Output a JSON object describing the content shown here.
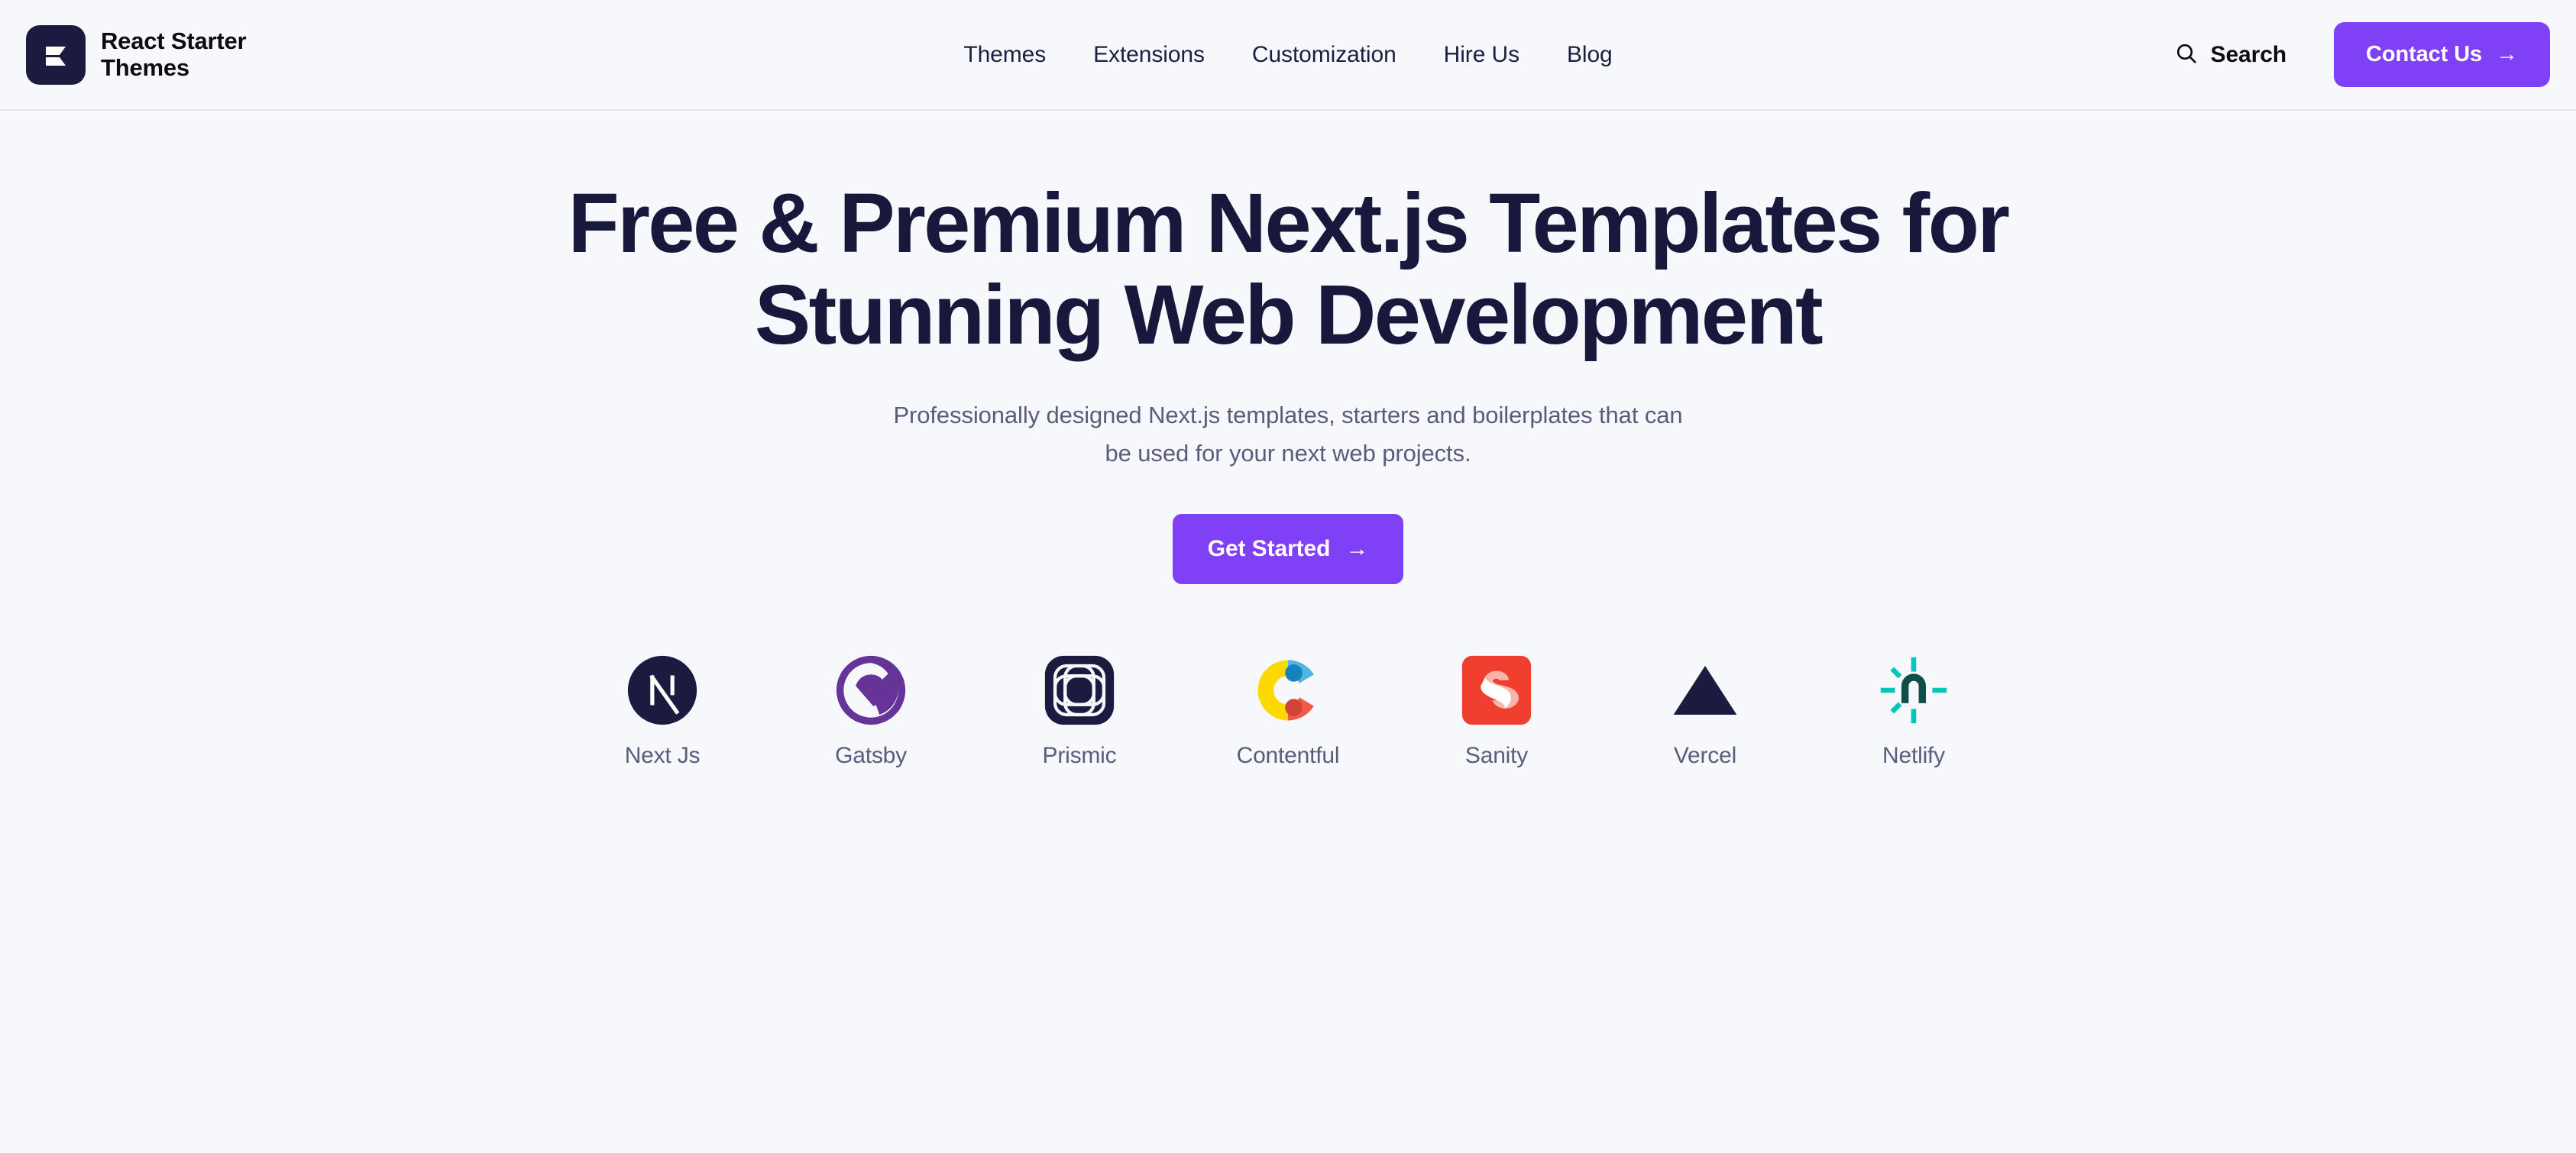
{
  "header": {
    "brand": {
      "name": "React Starter\nThemes",
      "logo_icon": "react-starter-themes-logo",
      "logo_bg": "#1b1b3f"
    },
    "nav": [
      {
        "label": "Themes"
      },
      {
        "label": "Extensions"
      },
      {
        "label": "Customization"
      },
      {
        "label": "Hire Us"
      },
      {
        "label": "Blog"
      }
    ],
    "search": {
      "label": "Search",
      "icon": "search-icon"
    },
    "contact": {
      "label": "Contact Us",
      "arrow": "→",
      "bg": "#8040f5",
      "color": "#ffffff"
    }
  },
  "hero": {
    "headline": "Free & Premium Next.js Templates for Stunning Web Development",
    "subtitle": "Professionally designed Next.js templates, starters and boilerplates that can be used for your next web projects.",
    "cta": {
      "label": "Get Started",
      "arrow": "→",
      "bg": "#8040f5",
      "color": "#ffffff"
    }
  },
  "tech_stack": [
    {
      "label": "Next Js",
      "icon": "nextjs-icon",
      "color": "#1b1b3f"
    },
    {
      "label": "Gatsby",
      "icon": "gatsby-icon",
      "color": "#663399"
    },
    {
      "label": "Prismic",
      "icon": "prismic-icon",
      "color": "#1b1b3f"
    },
    {
      "label": "Contentful",
      "icon": "contentful-icon",
      "color": "#4fb5e1"
    },
    {
      "label": "Sanity",
      "icon": "sanity-icon",
      "color": "#f03e2f"
    },
    {
      "label": "Vercel",
      "icon": "vercel-icon",
      "color": "#1b1b3f"
    },
    {
      "label": "Netlify",
      "icon": "netlify-icon",
      "color": "#00c7b7"
    }
  ],
  "theme": {
    "background": "#f7f8fc",
    "accent": "#8040f5",
    "heading_color": "#18183c",
    "muted_text": "#5b5b7c",
    "border": "#e4e6ef"
  }
}
